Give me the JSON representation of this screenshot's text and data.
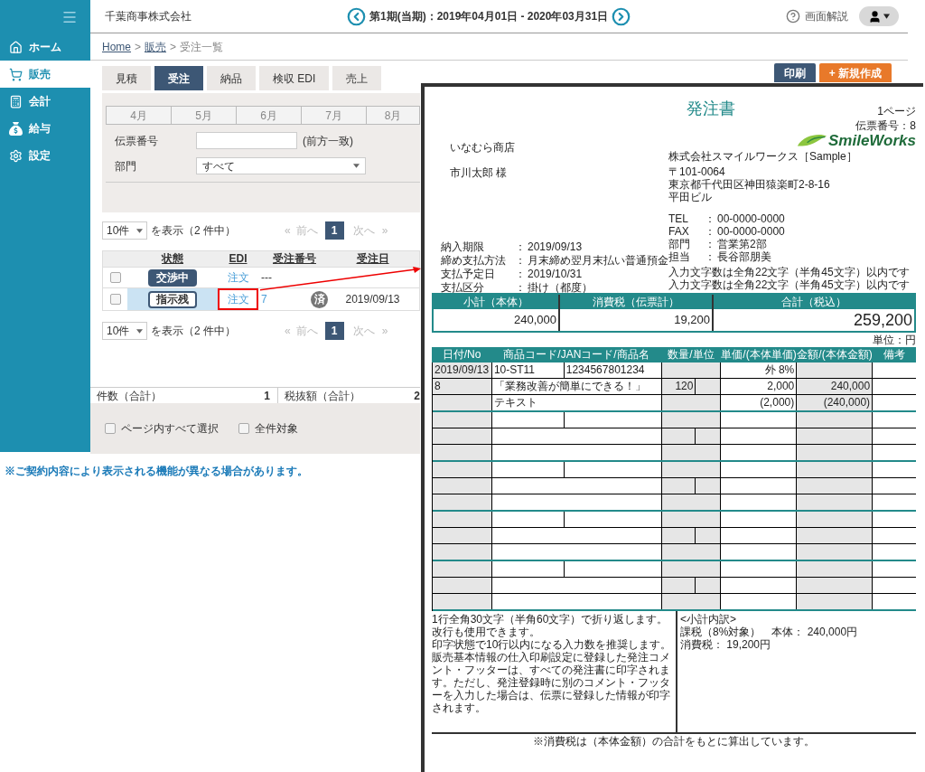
{
  "sidebar": {
    "items": [
      {
        "label": "ホーム",
        "selected": false
      },
      {
        "label": "販売",
        "selected": true
      },
      {
        "label": "会計",
        "selected": false
      },
      {
        "label": "給与",
        "selected": false
      },
      {
        "label": "設定",
        "selected": false
      }
    ]
  },
  "header": {
    "company": "千葉商事株式会社",
    "period": "第1期(当期)：2019年04月01日 - 2020年03月31日",
    "help": "画面解説"
  },
  "breadcrumb": [
    {
      "label": "Home",
      "kind": "link"
    },
    {
      "label": ">",
      "kind": "separator"
    },
    {
      "label": "販売",
      "kind": "link"
    },
    {
      "label": ">",
      "kind": "separator"
    },
    {
      "label": "受注一覧",
      "kind": "current"
    }
  ],
  "tabs": [
    {
      "label": "見積",
      "selected": false
    },
    {
      "label": "受注",
      "selected": true
    },
    {
      "label": "納品",
      "selected": false
    },
    {
      "label": "検収 EDI",
      "selected": false
    },
    {
      "label": "売上",
      "selected": false
    }
  ],
  "actions": [
    {
      "label": "印刷",
      "kind": "primary"
    },
    {
      "label": "+ 新規作成",
      "kind": "accent"
    }
  ],
  "months": [
    "4月",
    "5月",
    "6月",
    "7月",
    "8月"
  ],
  "filters": [
    {
      "label": "伝票番号",
      "kind": "text",
      "hint": "(前方一致)"
    },
    {
      "label": "部門",
      "kind": "select",
      "value": "すべて"
    }
  ],
  "pager_top": {
    "per_page": "10件",
    "summary": "を表示（2 件中）",
    "first": "«",
    "prev": "前へ",
    "page": "1",
    "next": "次へ",
    "last": "»"
  },
  "table": {
    "columns": [
      "状態",
      "EDI",
      "受注番号",
      "受注日"
    ],
    "rows": [
      {
        "checked": false,
        "selected": false,
        "callout": false,
        "status": "交渉中",
        "kind": "filled",
        "edi": "注文",
        "number": "---"
      },
      {
        "checked": false,
        "selected": true,
        "callout": true,
        "status": "指示残",
        "kind": "outline",
        "edi": "注文",
        "number": "7",
        "badge": "済",
        "date": "2019/09/13"
      }
    ]
  },
  "pager_bottom": {
    "per_page": "10件",
    "summary": "を表示（2 件中）",
    "first": "«",
    "prev": "前へ",
    "page": "1",
    "next": "次へ",
    "last": "»"
  },
  "summary": [
    {
      "label": "件数（合計）",
      "value": "1"
    },
    {
      "label": "税抜額（合計）",
      "value": "2"
    }
  ],
  "bulk": [
    {
      "label": "ページ内すべて選択",
      "checked": false
    },
    {
      "label": "全件対象",
      "checked": false
    }
  ],
  "notice": "※ご契約内容により表示される機能が異なる場合があります。",
  "document": {
    "title": "発注書",
    "page": "1ページ",
    "slip_no": "伝票番号：8",
    "customer": "いなむら商店",
    "contact": "市川太郎 様",
    "terms": [
      {
        "label": "納入期限",
        "sep": "：",
        "value": "2019/09/13"
      },
      {
        "label": "締め支払方法",
        "sep": "：",
        "value": "月末締め翌月末払い普通預金"
      },
      {
        "label": "支払予定日",
        "sep": "：",
        "value": "2019/10/31"
      },
      {
        "label": "支払区分",
        "sep": "：",
        "value": "掛け（都度）"
      }
    ],
    "logo_text": "SmileWorks",
    "company": "株式会社スマイルワークス［Sample］",
    "address": [
      "〒101-0064",
      "東京都千代田区神田猿楽町2-8-16",
      "平田ビル"
    ],
    "contacts": [
      {
        "label": "TEL",
        "sep": "：",
        "value": "00-0000-0000"
      },
      {
        "label": "FAX",
        "sep": "：",
        "value": "00-0000-0000"
      },
      {
        "label": "部門",
        "sep": "：",
        "value": "営業第2部"
      },
      {
        "label": "担当",
        "sep": "：",
        "value": "長谷部朋美"
      }
    ],
    "notes": [
      "入力文字数は全角22文字（半角45文字）以内です",
      "入力文字数は全角22文字（半角45文字）以内です"
    ],
    "totals": [
      {
        "label": "小計（本体）",
        "value": "240,000"
      },
      {
        "label": "消費税（伝票計）",
        "value": "19,200"
      },
      {
        "label": "合計（税込）",
        "value": "259,200"
      }
    ],
    "unit": "単位：円",
    "columns": [
      "日付/No",
      "商品コード/JANコード/商品名",
      "数量/単位",
      "単価/(本体単価)",
      "金額/(本体金額)",
      "備考"
    ],
    "items": [
      {
        "date": "2019/09/13",
        "code": "10-ST11",
        "jan": "1234567801234",
        "tax": "外 8%",
        "no": "8",
        "name": "「業務改善が簡単にできる！」",
        "quantity": "120",
        "price": "2,000",
        "amount": "240,000",
        "text": "テキスト",
        "base_price": "(2,000)",
        "base_amount": "(240,000)"
      }
    ],
    "comment": [
      "1行全角30文字（半角60文字）で折り返します。改行も使用できます。",
      "印字状態で10行以内になる入力数を推奨します。",
      "販売基本情報の仕入印刷設定に登録した発注コメント・フッターは、すべての発注書に印字されます。ただし、発注登録時に別のコメント・フッターを入力した場合は、伝票に登録した情報が印字されます。"
    ],
    "breakdown_title": "<小計内訳>",
    "breakdown": [
      "課税（8%対象）",
      "本体： 240,000円",
      "消費税： 19,200円"
    ],
    "footnote": "※消費税は（本体金額）の合計をもとに算出しています。"
  }
}
